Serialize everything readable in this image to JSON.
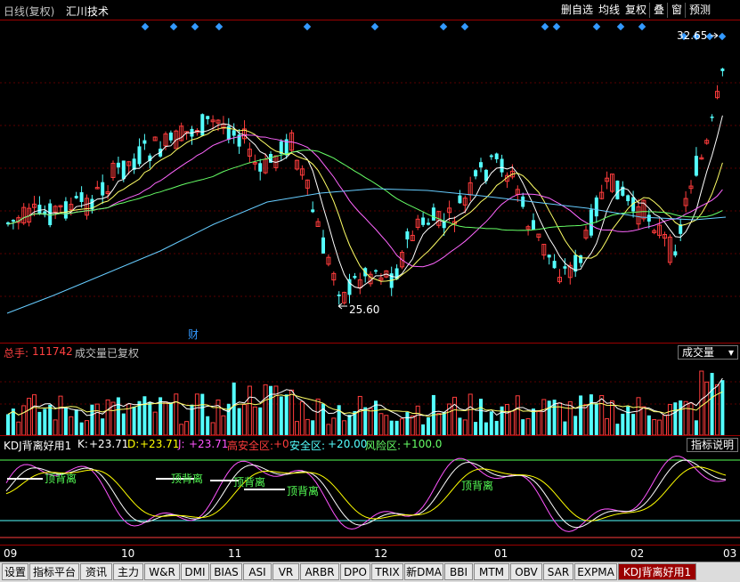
{
  "title_bar": {
    "period": "日线(复权)",
    "stock_name": "汇川技术",
    "buttons": [
      "删自选",
      "均线",
      "复权",
      "叠",
      "窗",
      "预测"
    ]
  },
  "price_panel": {
    "high_label": "32.65",
    "low_label": "25.60",
    "finance_marker": "财"
  },
  "volume_panel": {
    "total_label": "总手:",
    "total_value": "111742",
    "note": "成交量已复权",
    "selector": "成交量"
  },
  "kdj_panel": {
    "name": "KDJ背离好用1",
    "k_label": "K:",
    "k_value": "+23.71",
    "d_label": "D:",
    "d_value": "+23.71",
    "j_label": "J:",
    "j_value": "+23.71",
    "high_safe_label": "高安全区:",
    "high_safe_value": "+0",
    "safe_label": "安全区:",
    "safe_value": "+20.00",
    "risk_label": "风险区:",
    "risk_value": "+100.0",
    "explain_button": "指标说明",
    "divergence_label": "顶背离"
  },
  "date_axis": [
    "09",
    "10",
    "11",
    "12",
    "01",
    "02",
    "03"
  ],
  "tabs": [
    "设置",
    "指标平台",
    "资讯",
    "主力",
    "W&R",
    "DMI",
    "BIAS",
    "ASI",
    "VR",
    "ARBR",
    "DPO",
    "TRIX",
    "新DMA",
    "BBI",
    "MTM",
    "OBV",
    "SAR",
    "EXPMA",
    "KDJ背离好用1"
  ],
  "active_tab": "KDJ背离好用1",
  "colors": {
    "up": "#ff3c3c",
    "down": "#54ffff",
    "border": "#9b0000",
    "ma5": "#ffffff",
    "ma10": "#ffff66",
    "ma20": "#ff66ff",
    "ma30": "#66ff66",
    "ma60": "#66ccff",
    "k_line": "#ffffff",
    "d_line": "#ffff00",
    "j_line": "#ff55ff",
    "label_green": "#55ff55",
    "marker_blue": "#3399ff"
  }
}
